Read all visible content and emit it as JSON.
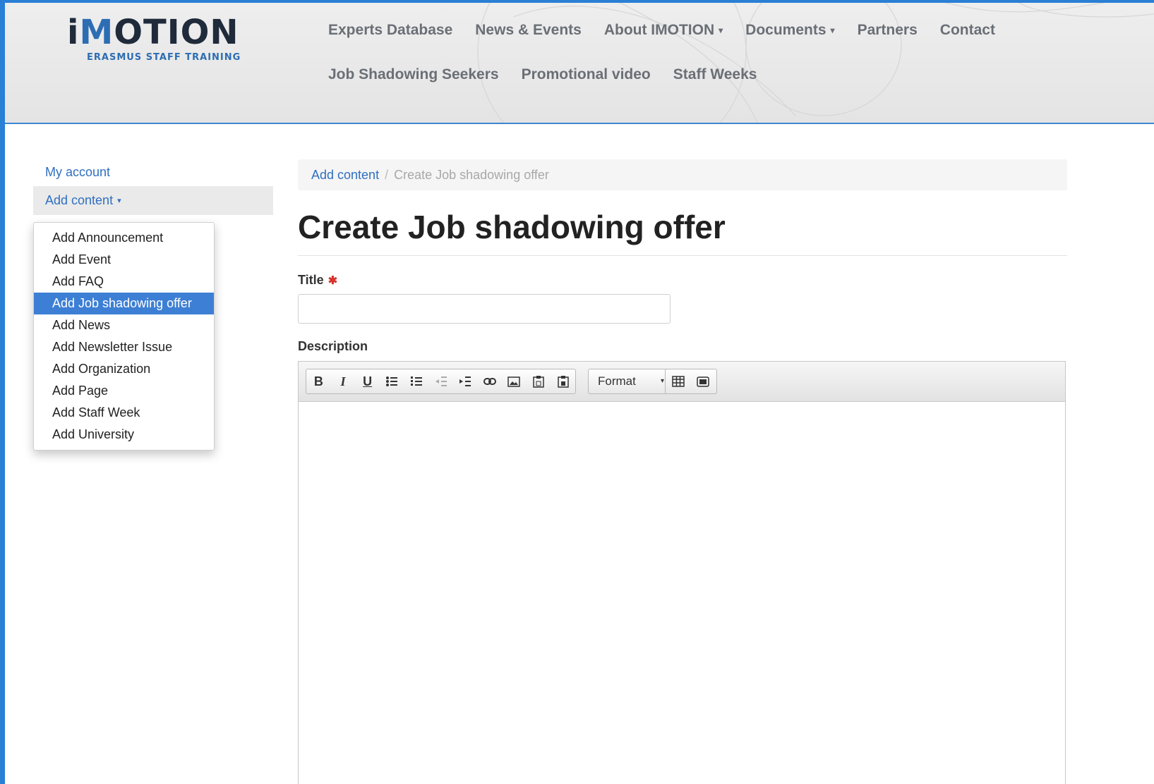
{
  "logo": {
    "text_pre": "i",
    "text_accent": "M",
    "text_post": "OTION",
    "subtitle": "ERASMUS STAFF TRAINING"
  },
  "nav": {
    "row1": [
      "Experts Database",
      "News & Events",
      "About IMOTION",
      "Documents",
      "Partners",
      "Contact"
    ],
    "row2": [
      "Job Shadowing Seekers",
      "Promotional video",
      "Staff Weeks"
    ]
  },
  "sidebar": {
    "my_account": "My account",
    "add_content": "Add content"
  },
  "dropdown": {
    "items": [
      "Add Announcement",
      "Add Event",
      "Add FAQ",
      "Add Job shadowing offer",
      "Add News",
      "Add Newsletter Issue",
      "Add Organization",
      "Add Page",
      "Add Staff Week",
      "Add University"
    ],
    "selected": "Add Job shadowing offer"
  },
  "breadcrumb": {
    "link": "Add content",
    "separator": "/",
    "current": "Create Job shadowing offer"
  },
  "page_title": "Create Job shadowing offer",
  "form": {
    "title_label": "Title",
    "required_mark": "✱",
    "title_value": "",
    "description_label": "Description",
    "format_label": "Format"
  },
  "toolbar_icons": [
    "bold-icon",
    "italic-icon",
    "underline-icon",
    "bulleted-list-icon",
    "numbered-list-icon",
    "outdent-icon",
    "indent-icon",
    "link-icon",
    "image-icon",
    "paste-text-icon",
    "paste-word-icon",
    "table-icon",
    "media-icon"
  ],
  "colors": {
    "accent": "#2f6fc0",
    "selected_bg": "#3d7fd4",
    "header_border": "#3d86d2",
    "required": "#d9322b"
  }
}
